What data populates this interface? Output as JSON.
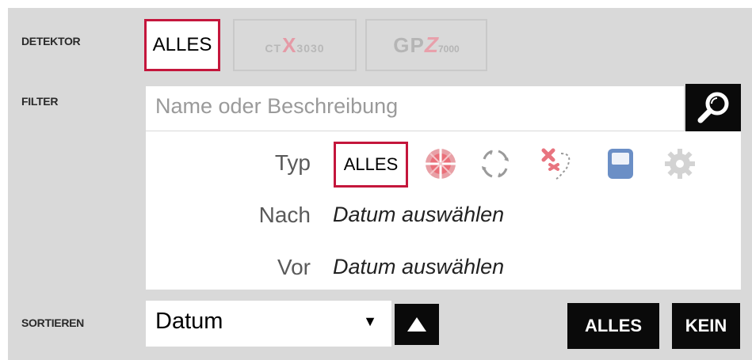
{
  "labels": {
    "detektor": "DETEKTOR",
    "filter": "FILTER",
    "sortieren": "SORTIEREN"
  },
  "detector": {
    "all_label": "ALLES",
    "logos": [
      {
        "icon": "ctx-3030-logo",
        "prefix": "CT",
        "mark": "X",
        "suffix": "3030"
      },
      {
        "icon": "gpz-7000-logo",
        "prefix": "GP",
        "mark": "Z",
        "suffix": "7000"
      }
    ]
  },
  "search": {
    "placeholder": "Name oder Beschreibung",
    "icon": "magnifier-icon"
  },
  "filters": {
    "typ_label": "Typ",
    "typ_all": "ALLES",
    "typ_icons": [
      "target-icon",
      "track-icon",
      "find-point-icon",
      "device-icon",
      "settings-gear-icon"
    ],
    "nach_label": "Nach",
    "nach_value": "Datum auswählen",
    "vor_label": "Vor",
    "vor_value": "Datum auswählen"
  },
  "sort": {
    "selected": "Datum",
    "dropdown_arrow": "▼",
    "direction_icon": "sort-ascending-icon"
  },
  "actions": {
    "all_label": "ALLES",
    "none_label": "KEIN"
  },
  "colors": {
    "panel_bg": "#d9d9d9",
    "accent": "#c4163c",
    "dark_button": "#0a0a0a",
    "icon_red": "#e8747f",
    "icon_blue": "#6b8fc6"
  }
}
